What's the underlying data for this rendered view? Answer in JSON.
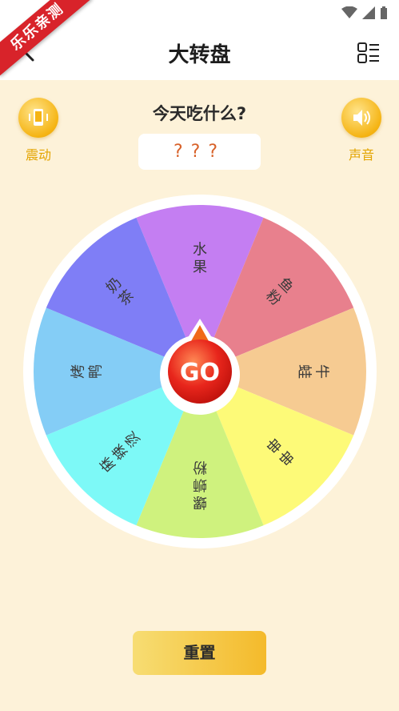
{
  "header": {
    "title": "大转盘",
    "ribbon_text": "乐乐亲测"
  },
  "controls": {
    "vibrate_label": "震动",
    "sound_label": "声音"
  },
  "question": "今天吃什么?",
  "result": "???",
  "wheel": {
    "go_label": "GO",
    "segments": [
      {
        "label": "水果",
        "color": "#c47ef2"
      },
      {
        "label": "鱼粉",
        "color": "#e8808d"
      },
      {
        "label": "牛蛙",
        "color": "#f6cb92"
      },
      {
        "label": "串串",
        "color": "#fdfa78"
      },
      {
        "label": "螺蛳粉",
        "color": "#cff27e"
      },
      {
        "label": "麻辣烫",
        "color": "#7df9f7"
      },
      {
        "label": "烤鸭",
        "color": "#84cdf6"
      },
      {
        "label": "奶茶",
        "color": "#7f7ef6"
      }
    ]
  },
  "reset_label": "重置",
  "colors": {
    "background": "#fdf2d9",
    "accent": "#f5b414",
    "go_button": "#e8261c"
  }
}
